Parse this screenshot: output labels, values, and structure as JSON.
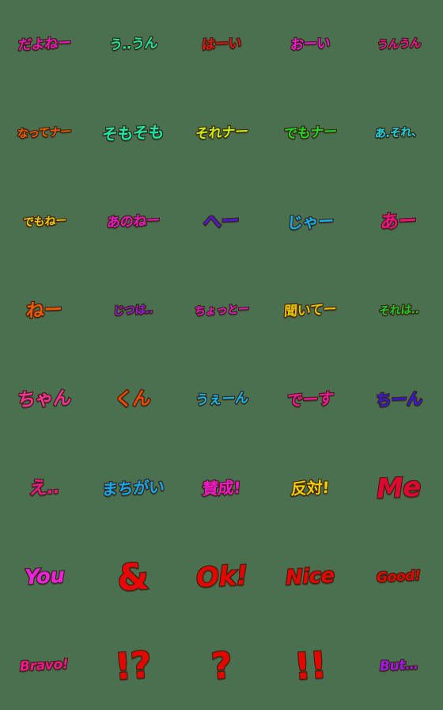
{
  "sheet": {
    "background_color": "#4a7050",
    "outline_color": "#3a2416",
    "columns": 5,
    "rows": 8,
    "total_items": 40
  },
  "items": [
    {
      "text": "だよねー",
      "color": "#e619b8",
      "color2": "#c81ad0",
      "script": "jp",
      "size": "jp",
      "name": "emoji-dayone"
    },
    {
      "text": "う‥うん",
      "color": "#14e8a0",
      "color2": "#18f0b4",
      "script": "jp",
      "size": "jp",
      "name": "emoji-uun"
    },
    {
      "text": "はーい",
      "color": "#e01414",
      "color2": "#f02020",
      "script": "jp",
      "size": "jp",
      "name": "emoji-haai"
    },
    {
      "text": "おーい",
      "color": "#f018d8",
      "color2": "#ef18e0",
      "script": "jp",
      "size": "jp",
      "name": "emoji-ooi"
    },
    {
      "text": "うんうん",
      "color": "#f01498",
      "color2": "#ff1e9e",
      "script": "jp",
      "size": "jp-sm",
      "name": "emoji-unun"
    },
    {
      "text": "なってナー",
      "color": "#f06000",
      "color2": "#ff7a10",
      "script": "jp",
      "size": "jp-sm",
      "name": "emoji-natsute-naa"
    },
    {
      "text": "そもそも",
      "color": "#16e8a8",
      "color2": "#30f0c0",
      "script": "jp",
      "size": "jp-md",
      "name": "emoji-somosomo"
    },
    {
      "text": "それナー",
      "color": "#c8f000",
      "color2": "#8ae000",
      "script": "jp",
      "size": "jp",
      "name": "emoji-sore-naa"
    },
    {
      "text": "でもナー",
      "color": "#20d820",
      "color2": "#40e830",
      "script": "jp",
      "size": "jp",
      "name": "emoji-demo-naa"
    },
    {
      "text": "あ.それ、",
      "color": "#10d8e8",
      "color2": "#20e0f0",
      "script": "jp",
      "size": "jp-sm",
      "name": "emoji-a-sore"
    },
    {
      "text": "でもねー",
      "color": "#f0c800",
      "color2": "#ffd810",
      "script": "jp",
      "size": "jp-sm",
      "name": "emoji-demo-nee"
    },
    {
      "text": "あのねー",
      "color": "#e818c0",
      "color2": "#f020d0",
      "script": "jp",
      "size": "jp",
      "name": "emoji-ano-nee"
    },
    {
      "text": "へー",
      "color": "#5018d8",
      "color2": "#6020e8",
      "script": "jp",
      "size": "jp-lg",
      "name": "emoji-hee"
    },
    {
      "text": "じゃー",
      "color": "#10b0f0",
      "color2": "#18c0ff",
      "script": "jp",
      "size": "jp-md",
      "name": "emoji-jaa"
    },
    {
      "text": "あー",
      "color": "#f01080",
      "color2": "#ff1890",
      "script": "jp",
      "size": "jp-lg",
      "name": "emoji-aa"
    },
    {
      "text": "ねー",
      "color": "#f05800",
      "color2": "#ff6810",
      "script": "jp",
      "size": "jp-lg",
      "name": "emoji-nee"
    },
    {
      "text": "じつは‥",
      "color": "#9818d8",
      "color2": "#a820e8",
      "script": "jp",
      "size": "jp-sm",
      "name": "emoji-jitsuwa"
    },
    {
      "text": "ちょっとー",
      "color": "#e818c8",
      "color2": "#f820d8",
      "script": "jp",
      "size": "jp-sm",
      "name": "emoji-chotto"
    },
    {
      "text": "聞いてー",
      "color": "#e8c000",
      "color2": "#f8d010",
      "script": "jp",
      "size": "jp",
      "name": "emoji-kiite"
    },
    {
      "text": "それは‥",
      "color": "#20c828",
      "color2": "#30d838",
      "script": "jp",
      "size": "jp-sm",
      "name": "emoji-sorewa"
    },
    {
      "text": "ちゃん",
      "color": "#f83098",
      "color2": "#ff48a8",
      "script": "jp",
      "size": "jp-lg",
      "name": "emoji-chan"
    },
    {
      "text": "くん",
      "color": "#f04800",
      "color2": "#ff5810",
      "script": "jp",
      "size": "jp-lg",
      "name": "emoji-kun"
    },
    {
      "text": "うぇーん",
      "color": "#10b8f0",
      "color2": "#18c8ff",
      "script": "jp",
      "size": "jp",
      "name": "emoji-ween"
    },
    {
      "text": "でーす",
      "color": "#f01898",
      "color2": "#ff20a8",
      "script": "jp",
      "size": "jp-md",
      "name": "emoji-desu"
    },
    {
      "text": "ちーん",
      "color": "#3818e0",
      "color2": "#7018d8",
      "script": "jp",
      "size": "jp-md",
      "name": "emoji-chiin"
    },
    {
      "text": "え‥",
      "color": "#f01888",
      "color2": "#ff2098",
      "script": "jp",
      "size": "jp-lg",
      "name": "emoji-e"
    },
    {
      "text": "まちがい",
      "color": "#10a8f0",
      "color2": "#18b8ff",
      "script": "jp",
      "size": "jp-md",
      "name": "emoji-machigai"
    },
    {
      "text": "賛成!",
      "color": "#f018c8",
      "color2": "#ff20d8",
      "script": "jp",
      "size": "jp-md",
      "name": "emoji-sansei"
    },
    {
      "text": "反対!",
      "color": "#f0d000",
      "color2": "#ffe010",
      "script": "jp",
      "size": "jp-md",
      "name": "emoji-hantai"
    },
    {
      "text": "Me",
      "color": "#e00830",
      "color2": "#f01040",
      "script": "lat",
      "size": "lat-lg",
      "name": "emoji-me"
    },
    {
      "text": "You",
      "color": "#f020e0",
      "color2": "#ff28f0",
      "script": "lat",
      "size": "lat",
      "name": "emoji-you"
    },
    {
      "text": "&",
      "color": "#e80808",
      "color2": "#f81010",
      "script": "punct",
      "size": "punct",
      "name": "emoji-ampersand"
    },
    {
      "text": "Ok!",
      "color": "#e00800",
      "color2": "#f01008",
      "script": "lat",
      "size": "lat-lg",
      "name": "emoji-ok"
    },
    {
      "text": "Nice",
      "color": "#e00800",
      "color2": "#f01008",
      "script": "lat",
      "size": "lat",
      "name": "emoji-nice"
    },
    {
      "text": "Good!",
      "color": "#e00800",
      "color2": "#f01008",
      "script": "lat",
      "size": "lat-sm",
      "name": "emoji-good"
    },
    {
      "text": "Bravo!",
      "color": "#f01888",
      "color2": "#ff2098",
      "script": "lat",
      "size": "lat-sm",
      "name": "emoji-bravo"
    },
    {
      "text": "!?",
      "color": "#e00800",
      "color2": "#f01008",
      "script": "punct",
      "size": "punct",
      "name": "emoji-interrobang"
    },
    {
      "text": "?",
      "color": "#e00800",
      "color2": "#f01008",
      "script": "punct",
      "size": "punct",
      "name": "emoji-question"
    },
    {
      "text": "!!",
      "color": "#e00800",
      "color2": "#f01008",
      "script": "punct",
      "size": "punct",
      "name": "emoji-double-exclamation"
    },
    {
      "text": "But…",
      "color": "#a018e8",
      "color2": "#c020f8",
      "script": "lat",
      "size": "lat-sm",
      "name": "emoji-but"
    }
  ]
}
